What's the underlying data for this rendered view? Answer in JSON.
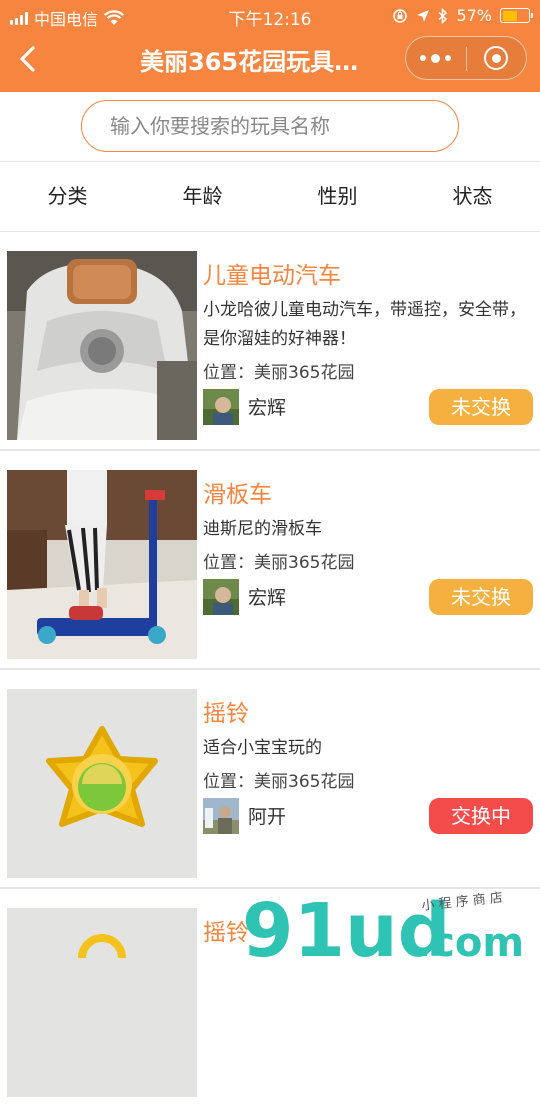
{
  "status_bar": {
    "carrier": "中国电信",
    "time": "下午12:16",
    "battery": "57%",
    "battery_level": 0.57
  },
  "nav": {
    "title": "美丽365花园玩具…"
  },
  "search": {
    "placeholder": "输入你要搜索的玩具名称"
  },
  "filters": [
    "分类",
    "年龄",
    "性别",
    "状态"
  ],
  "location_prefix": "位置：",
  "toys": [
    {
      "name": "儿童电动汽车",
      "desc": "小龙哈彼儿童电动汽车，带遥控，安全带，是你溜娃的好神器！",
      "location": "美丽365花园",
      "owner": "宏辉",
      "status": "未交换"
    },
    {
      "name": "滑板车",
      "desc": "迪斯尼的滑板车",
      "location": "美丽365花园",
      "owner": "宏辉",
      "status": "未交换"
    },
    {
      "name": "摇铃",
      "desc": "适合小宝宝玩的",
      "location": "美丽365花园",
      "owner": "阿开",
      "status": "交换中"
    },
    {
      "name": "摇铃"
    }
  ],
  "watermark": {
    "brand": "91ud",
    "domain": ".com",
    "tagline": "小 程 序 商 店"
  },
  "colors": {
    "accent": "#f5853f",
    "pending": "#f6b040",
    "exchanging": "#f44b4b"
  }
}
